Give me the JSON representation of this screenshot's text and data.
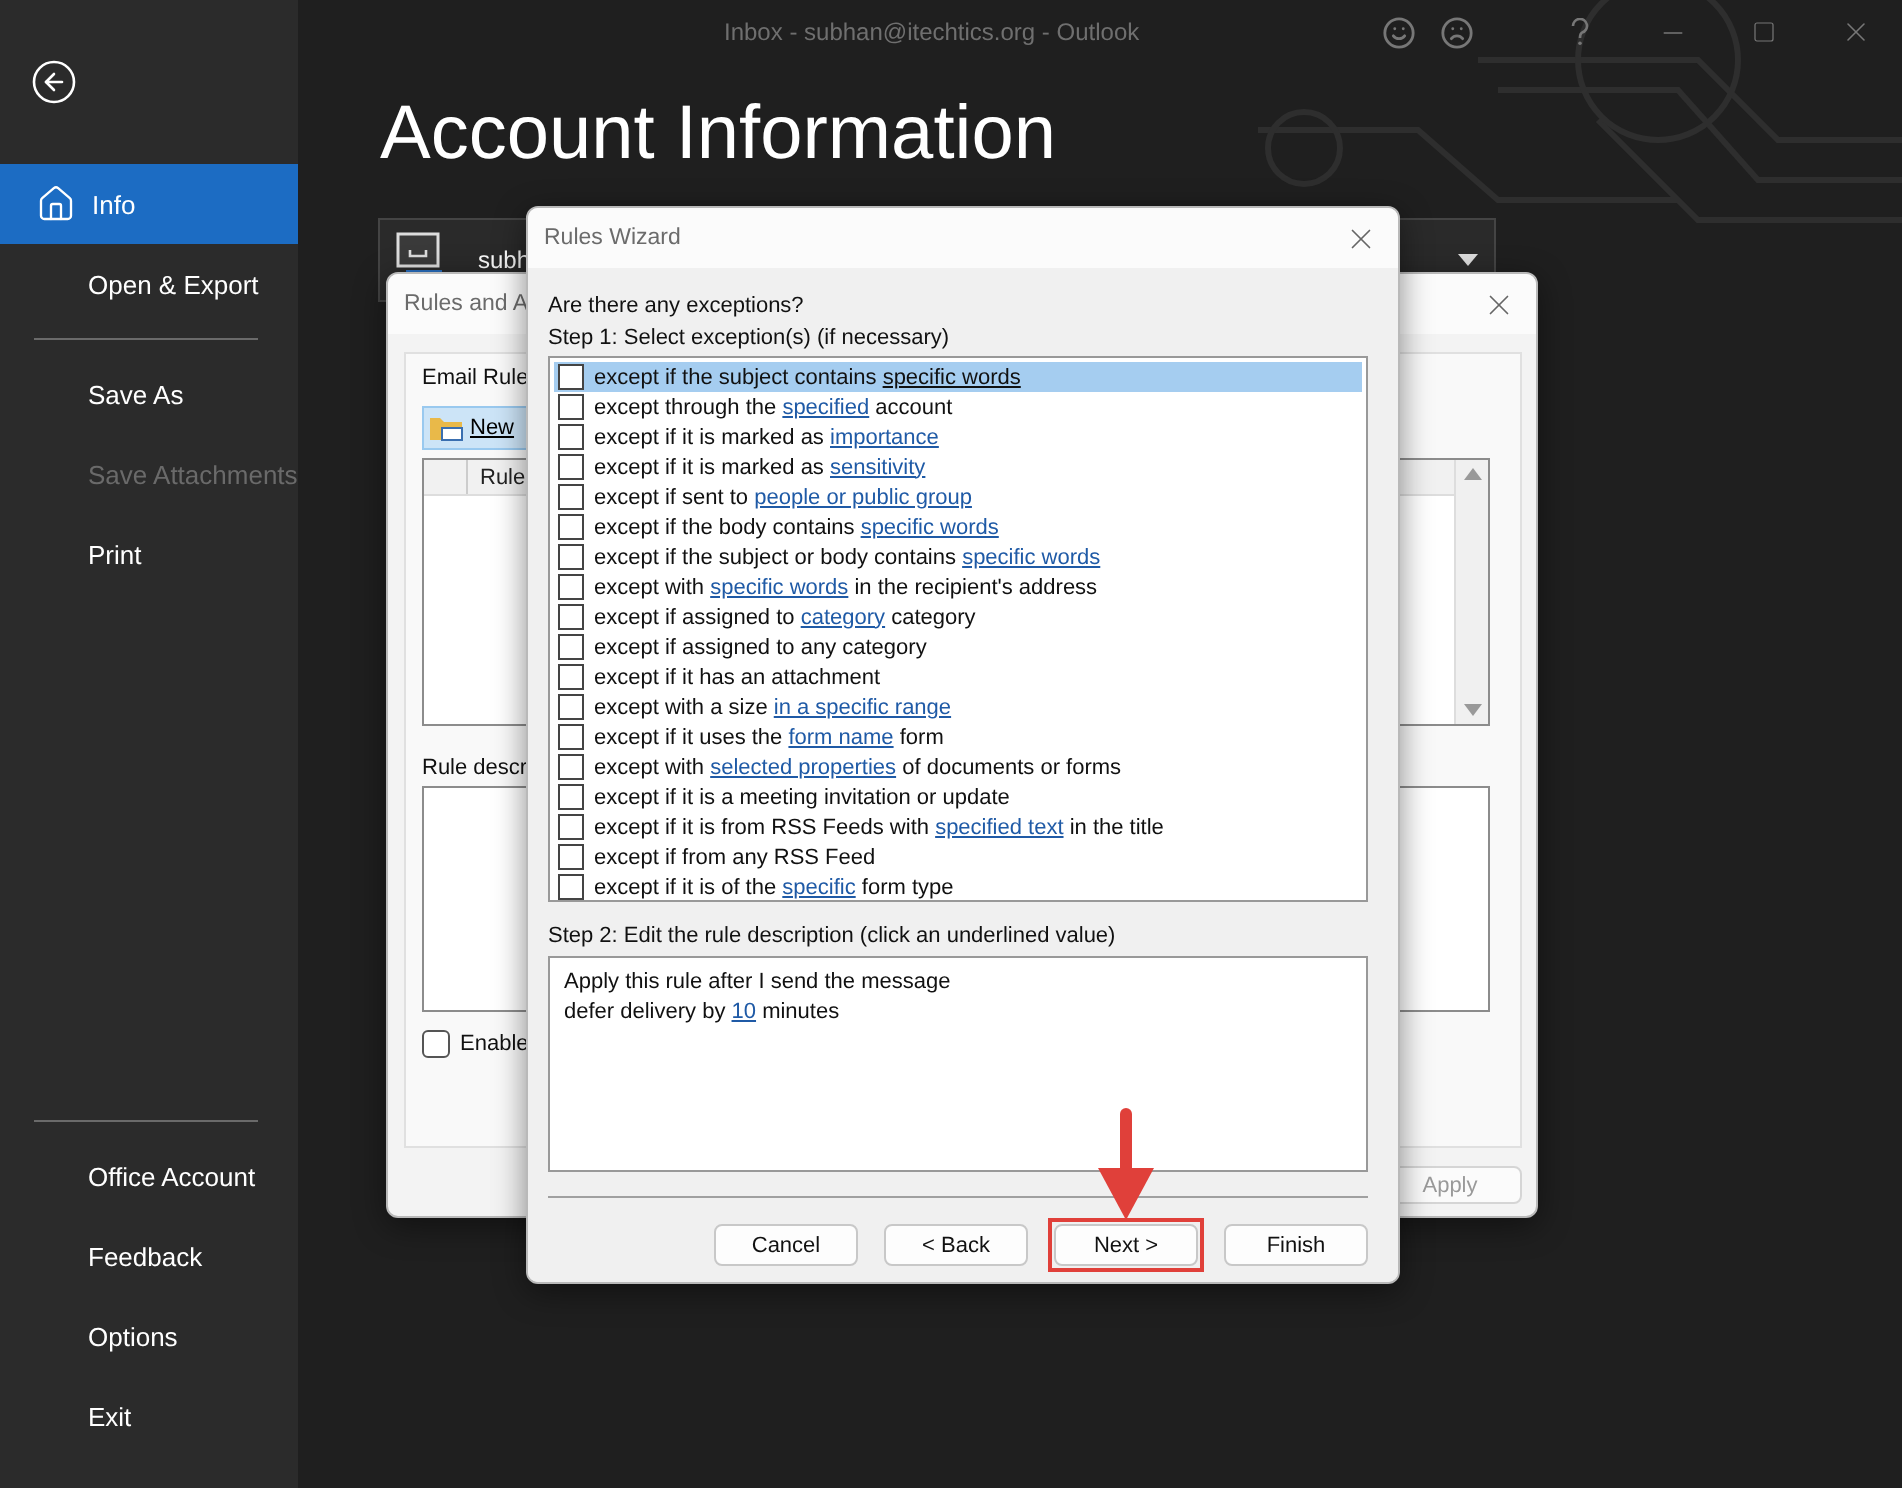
{
  "window": {
    "title": "Inbox - subhan@itechtics.org - Outlook"
  },
  "sidebar": {
    "groups": [
      [
        {
          "label": "Info",
          "selected": true,
          "disabled": false
        },
        {
          "label": "Open & Export",
          "selected": false,
          "disabled": false
        }
      ],
      [
        {
          "label": "Save As",
          "selected": false,
          "disabled": false
        },
        {
          "label": "Save Attachments",
          "selected": false,
          "disabled": true
        },
        {
          "label": "Print",
          "selected": false,
          "disabled": false
        }
      ]
    ],
    "footer_items": [
      {
        "label": "Office Account",
        "selected": false,
        "disabled": false
      },
      {
        "label": "Feedback",
        "selected": false,
        "disabled": false
      },
      {
        "label": "Options",
        "selected": false,
        "disabled": false
      },
      {
        "label": "Exit",
        "selected": false,
        "disabled": false
      }
    ]
  },
  "page": {
    "heading": "Account Information",
    "account": {
      "label": "subh"
    }
  },
  "rules_and_alerts": {
    "title": "Rules and A",
    "tab_label": "Email Rule",
    "new_button": "New",
    "column_header": "Rule",
    "description_label": "Rule descr",
    "enable_checkbox": {
      "label": "Enable",
      "checked": false
    },
    "apply_button": {
      "label": "Apply",
      "disabled": true
    }
  },
  "rules_wizard": {
    "title": "Rules Wizard",
    "question": "Are there any exceptions?",
    "step1_label": "Step 1: Select exception(s) (if necessary)",
    "exceptions": [
      {
        "selected": true,
        "checked": false,
        "parts": [
          {
            "text": "except if the subject contains ",
            "link": false
          },
          {
            "text": "specific words",
            "link": true
          }
        ]
      },
      {
        "selected": false,
        "checked": false,
        "parts": [
          {
            "text": "except through the ",
            "link": false
          },
          {
            "text": "specified",
            "link": true
          },
          {
            "text": " account",
            "link": false
          }
        ]
      },
      {
        "selected": false,
        "checked": false,
        "parts": [
          {
            "text": "except if it is marked as ",
            "link": false
          },
          {
            "text": "importance",
            "link": true
          }
        ]
      },
      {
        "selected": false,
        "checked": false,
        "parts": [
          {
            "text": "except if it is marked as ",
            "link": false
          },
          {
            "text": "sensitivity",
            "link": true
          }
        ]
      },
      {
        "selected": false,
        "checked": false,
        "parts": [
          {
            "text": "except if sent to ",
            "link": false
          },
          {
            "text": "people or public group",
            "link": true
          }
        ]
      },
      {
        "selected": false,
        "checked": false,
        "parts": [
          {
            "text": "except if the body contains ",
            "link": false
          },
          {
            "text": "specific words",
            "link": true
          }
        ]
      },
      {
        "selected": false,
        "checked": false,
        "parts": [
          {
            "text": "except if the subject or body contains ",
            "link": false
          },
          {
            "text": "specific words",
            "link": true
          }
        ]
      },
      {
        "selected": false,
        "checked": false,
        "parts": [
          {
            "text": "except with ",
            "link": false
          },
          {
            "text": "specific words",
            "link": true
          },
          {
            "text": " in the recipient's address",
            "link": false
          }
        ]
      },
      {
        "selected": false,
        "checked": false,
        "parts": [
          {
            "text": "except if assigned to ",
            "link": false
          },
          {
            "text": "category",
            "link": true
          },
          {
            "text": " category",
            "link": false
          }
        ]
      },
      {
        "selected": false,
        "checked": false,
        "parts": [
          {
            "text": "except if assigned to any category",
            "link": false
          }
        ]
      },
      {
        "selected": false,
        "checked": false,
        "parts": [
          {
            "text": "except if it has an attachment",
            "link": false
          }
        ]
      },
      {
        "selected": false,
        "checked": false,
        "parts": [
          {
            "text": "except with a size ",
            "link": false
          },
          {
            "text": "in a specific range",
            "link": true
          }
        ]
      },
      {
        "selected": false,
        "checked": false,
        "parts": [
          {
            "text": "except if it uses the ",
            "link": false
          },
          {
            "text": "form name",
            "link": true
          },
          {
            "text": " form",
            "link": false
          }
        ]
      },
      {
        "selected": false,
        "checked": false,
        "parts": [
          {
            "text": "except with ",
            "link": false
          },
          {
            "text": "selected properties",
            "link": true
          },
          {
            "text": " of documents or forms",
            "link": false
          }
        ]
      },
      {
        "selected": false,
        "checked": false,
        "parts": [
          {
            "text": "except if it is a meeting invitation or update",
            "link": false
          }
        ]
      },
      {
        "selected": false,
        "checked": false,
        "parts": [
          {
            "text": "except if it is from RSS Feeds with ",
            "link": false
          },
          {
            "text": "specified text",
            "link": true
          },
          {
            "text": " in the title",
            "link": false
          }
        ]
      },
      {
        "selected": false,
        "checked": false,
        "parts": [
          {
            "text": "except if from any RSS Feed",
            "link": false
          }
        ]
      },
      {
        "selected": false,
        "checked": false,
        "parts": [
          {
            "text": "except if it is of the ",
            "link": false
          },
          {
            "text": "specific",
            "link": true
          },
          {
            "text": " form type",
            "link": false
          }
        ]
      }
    ],
    "step2_label": "Step 2: Edit the rule description (click an underlined value)",
    "description": [
      [
        {
          "text": "Apply this rule after I send the message",
          "link": false
        }
      ],
      [
        {
          "text": "defer delivery by ",
          "link": false
        },
        {
          "text": "10",
          "link": true
        },
        {
          "text": " minutes",
          "link": false
        }
      ]
    ],
    "buttons": [
      {
        "label": "Cancel",
        "highlighted": false
      },
      {
        "label": "< Back",
        "highlighted": false
      },
      {
        "label": "Next >",
        "highlighted": true
      },
      {
        "label": "Finish",
        "highlighted": false
      }
    ]
  }
}
